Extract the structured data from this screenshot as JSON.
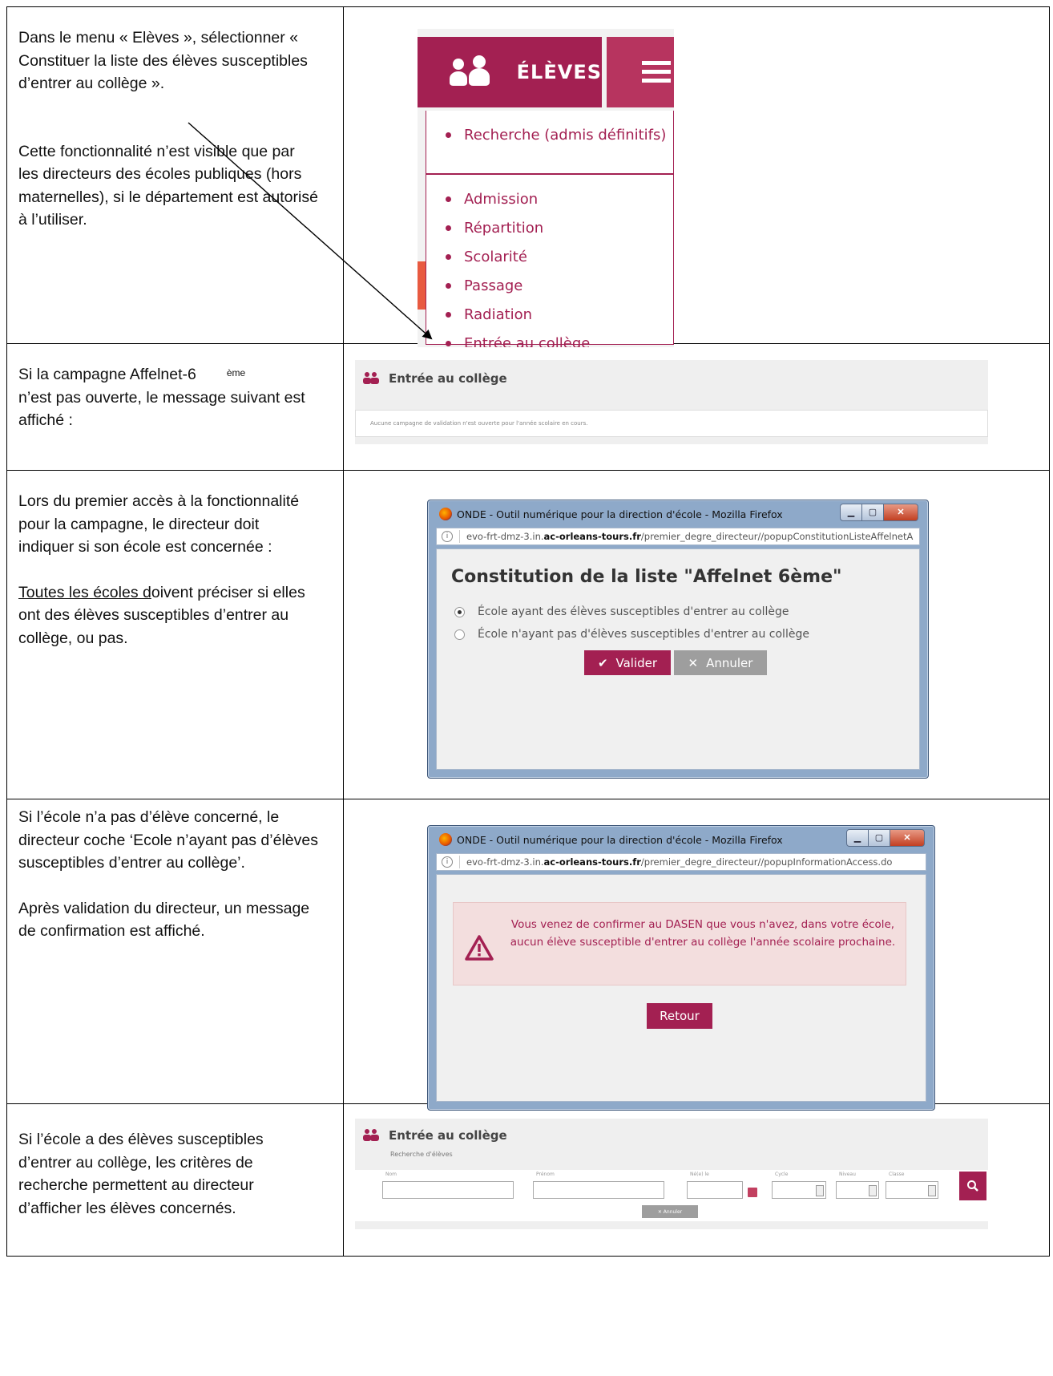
{
  "row1": {
    "text_p1": "Dans le menu « Elèves », sélectionner « Constituer la liste des élèves susceptibles d’entrer au collège ».",
    "text_p2": "Cette fonctionnalité n’est visible que par les directeurs des écoles publiques (hors maternelles), si le département est autorisé à l’utiliser.",
    "menu": {
      "title": "ÉLÈVES",
      "items": [
        "Recherche (admis définitifs)",
        "Admission",
        "Répartition",
        "Scolarité",
        "Passage",
        "Radiation",
        "Entrée au collège"
      ],
      "accent_color": "#a32052"
    }
  },
  "row2": {
    "text_a": "Si la campagne Affelnet-6",
    "text_sup": "ème",
    "text_b": "n’est pas ouverte, le message suivant est affiché :",
    "screen_title": "Entrée au collège",
    "screen_message": "Aucune campagne de validation n'est ouverte pour l'année scolaire en cours."
  },
  "row3": {
    "text_p1": "Lors du premier accès à la fonctionnalité pour la campagne, le directeur doit indiquer si son école est concernée :",
    "text_p2_u": "Toutes les écoles d",
    "text_p2_rest": "oivent préciser si elles ont des élèves susceptibles d’entrer au collège, ou pas.",
    "window_title": "ONDE - Outil numérique pour la direction d'école - Mozilla Firefox",
    "url_prefix": "evo-frt-dmz-3.in.",
    "url_domain": "ac-orleans-tours.fr",
    "url_path": "/premier_degre_directeur//popupConstitutionListeAffelnetA",
    "dialog_title": "Constitution de la liste \"Affelnet 6ème\"",
    "option1": "École ayant des élèves susceptibles d'entrer au collège",
    "option2": "École n'ayant pas d'élèves susceptibles d'entrer au collège",
    "btn_validate": "Valider",
    "btn_cancel": "Annuler"
  },
  "row4": {
    "text_p1": "Si l’école n’a pas d’élève concerné, le directeur coche ‘Ecole n’ayant pas d’élèves susceptibles d’entrer au collège’.",
    "text_p2": "Après validation du directeur, un message de confirmation est affiché.",
    "window_title": "ONDE - Outil numérique pour la direction d'école - Mozilla Firefox",
    "url_prefix": "evo-frt-dmz-3.in.",
    "url_domain": "ac-orleans-tours.fr",
    "url_path": "/premier_degre_directeur//popupInformationAccess.do",
    "alert_message": "Vous venez de confirmer au DASEN que vous n'avez, dans votre école, aucun élève susceptible d'entrer au collège l'année scolaire prochaine.",
    "btn_return": "Retour"
  },
  "row5": {
    "text_p1": "Si l’école a des élèves susceptibles d’entrer au collège, les critères de recherche permettent au directeur d’afficher les élèves concernés.",
    "screen_title": "Entrée au collège",
    "screen_subtitle": "Recherche d'élèves",
    "field_nom": "Nom",
    "field_prenom": "Prénom",
    "field_ne_le": "Né(e) le",
    "field_cycle": "Cycle",
    "field_niveau": "Niveau",
    "field_classe": "Classe",
    "btn_cancel": "Annuler"
  }
}
